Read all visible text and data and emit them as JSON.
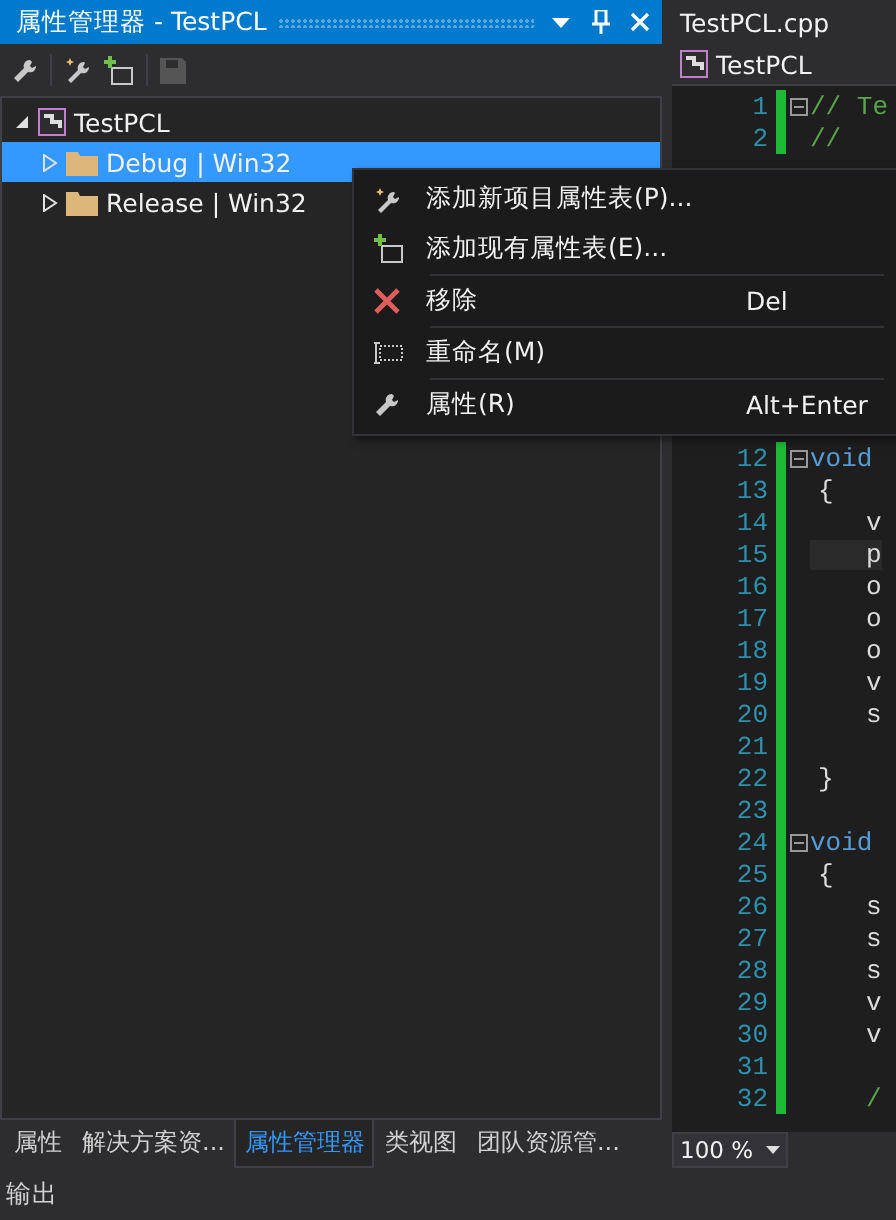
{
  "panel": {
    "title": "属性管理器 - TestPCL"
  },
  "tree": [
    {
      "label": "TestPCL",
      "expanded": true,
      "selected": false,
      "children": [
        {
          "label": "Debug | Win32",
          "expanded": false,
          "selected": true
        },
        {
          "label": "Release | Win32",
          "expanded": false,
          "selected": false
        }
      ]
    }
  ],
  "context_menu": [
    {
      "kind": "item",
      "label": "添加新项目属性表(P)..."
    },
    {
      "kind": "item",
      "label": "添加现有属性表(E)..."
    },
    {
      "kind": "separator"
    },
    {
      "kind": "item",
      "label": "移除",
      "shortcut": "Del"
    },
    {
      "kind": "separator"
    },
    {
      "kind": "item",
      "label": "重命名(M)"
    },
    {
      "kind": "separator"
    },
    {
      "kind": "item",
      "label": "属性(R)",
      "shortcut": "Alt+Enter"
    }
  ],
  "bottom_tabs": [
    {
      "label": "属性",
      "selected": false
    },
    {
      "label": "解决方案资...",
      "selected": false
    },
    {
      "label": "属性管理器",
      "selected": true
    },
    {
      "label": "类视图",
      "selected": false
    },
    {
      "label": "团队资源管...",
      "selected": false
    }
  ],
  "output_tab": "输出",
  "editor": {
    "tab": "TestPCL.cpp",
    "scope": "TestPCL",
    "zoom": "100 %",
    "top_lines": [
      {
        "number": "1",
        "code": "// Te",
        "fold": true,
        "kind": "comment"
      },
      {
        "number": "2",
        "code": "//",
        "fold": false,
        "kind": "comment"
      }
    ],
    "lines": [
      {
        "number": "12",
        "code": "void",
        "fold": true,
        "kind": "keyword"
      },
      {
        "number": "13",
        "code": "{",
        "fold": false,
        "kind": "brace"
      },
      {
        "number": "14",
        "code": "v",
        "fold": false,
        "kind": "indent"
      },
      {
        "number": "15",
        "code": "p",
        "fold": false,
        "kind": "indent",
        "current": true
      },
      {
        "number": "16",
        "code": "o",
        "fold": false,
        "kind": "indent"
      },
      {
        "number": "17",
        "code": "o",
        "fold": false,
        "kind": "indent"
      },
      {
        "number": "18",
        "code": "o",
        "fold": false,
        "kind": "indent"
      },
      {
        "number": "19",
        "code": "v",
        "fold": false,
        "kind": "indent"
      },
      {
        "number": "20",
        "code": "s",
        "fold": false,
        "kind": "indent"
      },
      {
        "number": "21",
        "fold": false,
        "kind": "plain"
      },
      {
        "number": "22",
        "code": "}",
        "fold": false,
        "kind": "brace"
      },
      {
        "number": "23",
        "fold": false,
        "kind": "plain"
      },
      {
        "number": "24",
        "code": "void",
        "fold": true,
        "kind": "keyword"
      },
      {
        "number": "25",
        "code": "{",
        "fold": false,
        "kind": "brace"
      },
      {
        "number": "26",
        "code": "s",
        "fold": false,
        "kind": "indent"
      },
      {
        "number": "27",
        "code": "s",
        "fold": false,
        "kind": "indent"
      },
      {
        "number": "28",
        "code": "s",
        "fold": false,
        "kind": "indent"
      },
      {
        "number": "29",
        "code": "v",
        "fold": false,
        "kind": "indent"
      },
      {
        "number": "30",
        "code": "v",
        "fold": false,
        "kind": "indent"
      },
      {
        "number": "31",
        "fold": false,
        "kind": "plain"
      },
      {
        "number": "32",
        "code": "/",
        "fold": false,
        "kind": "indent-comment"
      }
    ]
  }
}
